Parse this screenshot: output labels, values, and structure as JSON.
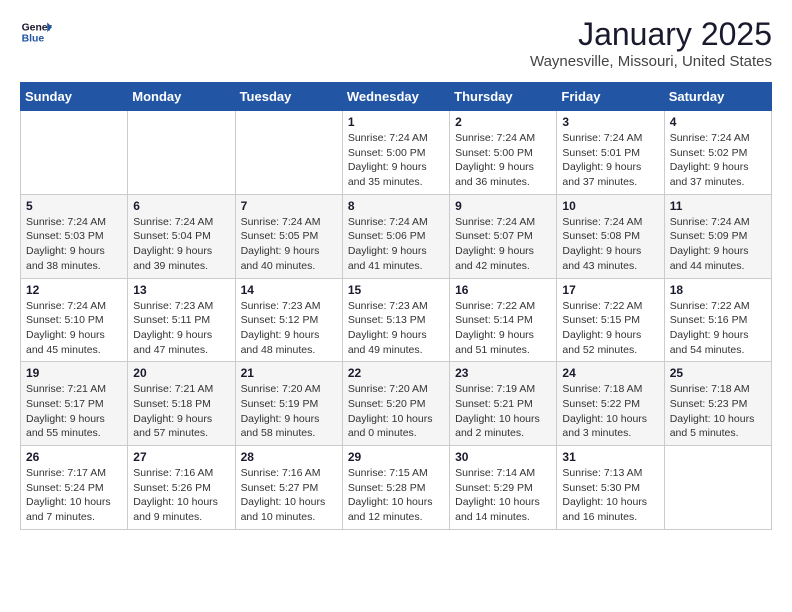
{
  "logo": {
    "general": "General",
    "blue": "Blue"
  },
  "title": "January 2025",
  "subtitle": "Waynesville, Missouri, United States",
  "weekdays": [
    "Sunday",
    "Monday",
    "Tuesday",
    "Wednesday",
    "Thursday",
    "Friday",
    "Saturday"
  ],
  "weeks": [
    [
      {
        "day": "",
        "info": ""
      },
      {
        "day": "",
        "info": ""
      },
      {
        "day": "",
        "info": ""
      },
      {
        "day": "1",
        "info": "Sunrise: 7:24 AM\nSunset: 5:00 PM\nDaylight: 9 hours\nand 35 minutes."
      },
      {
        "day": "2",
        "info": "Sunrise: 7:24 AM\nSunset: 5:00 PM\nDaylight: 9 hours\nand 36 minutes."
      },
      {
        "day": "3",
        "info": "Sunrise: 7:24 AM\nSunset: 5:01 PM\nDaylight: 9 hours\nand 37 minutes."
      },
      {
        "day": "4",
        "info": "Sunrise: 7:24 AM\nSunset: 5:02 PM\nDaylight: 9 hours\nand 37 minutes."
      }
    ],
    [
      {
        "day": "5",
        "info": "Sunrise: 7:24 AM\nSunset: 5:03 PM\nDaylight: 9 hours\nand 38 minutes."
      },
      {
        "day": "6",
        "info": "Sunrise: 7:24 AM\nSunset: 5:04 PM\nDaylight: 9 hours\nand 39 minutes."
      },
      {
        "day": "7",
        "info": "Sunrise: 7:24 AM\nSunset: 5:05 PM\nDaylight: 9 hours\nand 40 minutes."
      },
      {
        "day": "8",
        "info": "Sunrise: 7:24 AM\nSunset: 5:06 PM\nDaylight: 9 hours\nand 41 minutes."
      },
      {
        "day": "9",
        "info": "Sunrise: 7:24 AM\nSunset: 5:07 PM\nDaylight: 9 hours\nand 42 minutes."
      },
      {
        "day": "10",
        "info": "Sunrise: 7:24 AM\nSunset: 5:08 PM\nDaylight: 9 hours\nand 43 minutes."
      },
      {
        "day": "11",
        "info": "Sunrise: 7:24 AM\nSunset: 5:09 PM\nDaylight: 9 hours\nand 44 minutes."
      }
    ],
    [
      {
        "day": "12",
        "info": "Sunrise: 7:24 AM\nSunset: 5:10 PM\nDaylight: 9 hours\nand 45 minutes."
      },
      {
        "day": "13",
        "info": "Sunrise: 7:23 AM\nSunset: 5:11 PM\nDaylight: 9 hours\nand 47 minutes."
      },
      {
        "day": "14",
        "info": "Sunrise: 7:23 AM\nSunset: 5:12 PM\nDaylight: 9 hours\nand 48 minutes."
      },
      {
        "day": "15",
        "info": "Sunrise: 7:23 AM\nSunset: 5:13 PM\nDaylight: 9 hours\nand 49 minutes."
      },
      {
        "day": "16",
        "info": "Sunrise: 7:22 AM\nSunset: 5:14 PM\nDaylight: 9 hours\nand 51 minutes."
      },
      {
        "day": "17",
        "info": "Sunrise: 7:22 AM\nSunset: 5:15 PM\nDaylight: 9 hours\nand 52 minutes."
      },
      {
        "day": "18",
        "info": "Sunrise: 7:22 AM\nSunset: 5:16 PM\nDaylight: 9 hours\nand 54 minutes."
      }
    ],
    [
      {
        "day": "19",
        "info": "Sunrise: 7:21 AM\nSunset: 5:17 PM\nDaylight: 9 hours\nand 55 minutes."
      },
      {
        "day": "20",
        "info": "Sunrise: 7:21 AM\nSunset: 5:18 PM\nDaylight: 9 hours\nand 57 minutes."
      },
      {
        "day": "21",
        "info": "Sunrise: 7:20 AM\nSunset: 5:19 PM\nDaylight: 9 hours\nand 58 minutes."
      },
      {
        "day": "22",
        "info": "Sunrise: 7:20 AM\nSunset: 5:20 PM\nDaylight: 10 hours\nand 0 minutes."
      },
      {
        "day": "23",
        "info": "Sunrise: 7:19 AM\nSunset: 5:21 PM\nDaylight: 10 hours\nand 2 minutes."
      },
      {
        "day": "24",
        "info": "Sunrise: 7:18 AM\nSunset: 5:22 PM\nDaylight: 10 hours\nand 3 minutes."
      },
      {
        "day": "25",
        "info": "Sunrise: 7:18 AM\nSunset: 5:23 PM\nDaylight: 10 hours\nand 5 minutes."
      }
    ],
    [
      {
        "day": "26",
        "info": "Sunrise: 7:17 AM\nSunset: 5:24 PM\nDaylight: 10 hours\nand 7 minutes."
      },
      {
        "day": "27",
        "info": "Sunrise: 7:16 AM\nSunset: 5:26 PM\nDaylight: 10 hours\nand 9 minutes."
      },
      {
        "day": "28",
        "info": "Sunrise: 7:16 AM\nSunset: 5:27 PM\nDaylight: 10 hours\nand 10 minutes."
      },
      {
        "day": "29",
        "info": "Sunrise: 7:15 AM\nSunset: 5:28 PM\nDaylight: 10 hours\nand 12 minutes."
      },
      {
        "day": "30",
        "info": "Sunrise: 7:14 AM\nSunset: 5:29 PM\nDaylight: 10 hours\nand 14 minutes."
      },
      {
        "day": "31",
        "info": "Sunrise: 7:13 AM\nSunset: 5:30 PM\nDaylight: 10 hours\nand 16 minutes."
      },
      {
        "day": "",
        "info": ""
      }
    ]
  ]
}
